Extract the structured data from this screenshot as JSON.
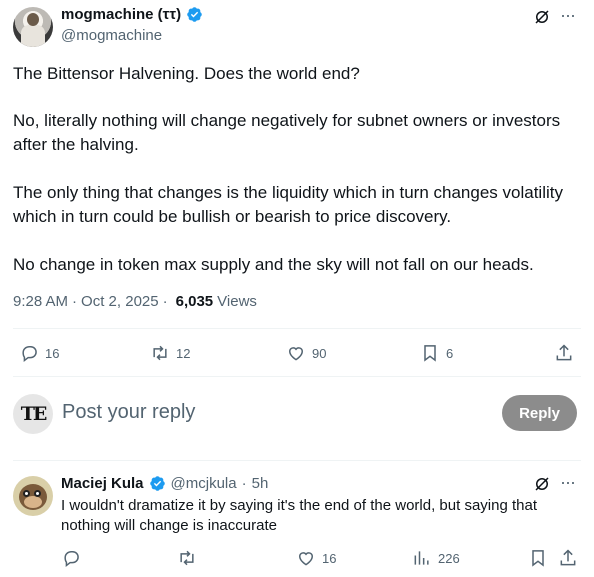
{
  "tweet": {
    "display_name": "mogmachine (ττ)",
    "handle": "@mogmachine",
    "paragraphs": [
      "The Bittensor Halvening. Does the world end?",
      "No, literally nothing will change negatively for subnet owners or investors after the halving.",
      "The only thing that changes is the liquidity which in turn changes volatility which in turn could be bullish or bearish to price discovery.",
      "No change in token max supply and the sky will not fall on our heads."
    ],
    "time": "9:28 AM",
    "date": "Oct 2, 2025",
    "views_count": "6,035",
    "views_label": "Views",
    "metrics": {
      "replies": "16",
      "reposts": "12",
      "likes": "90",
      "bookmarks": "6"
    }
  },
  "composer": {
    "avatar_text": "TE",
    "placeholder": "Post your reply",
    "button_label": "Reply"
  },
  "reply": {
    "display_name": "Maciej Kula",
    "handle": "@mcjkula",
    "time_ago": "5h",
    "text": "I wouldn't dramatize it by saying it's the end of the world, but saying that nothing will change is inaccurate",
    "metrics": {
      "likes": "16",
      "views": "226"
    }
  },
  "colors": {
    "verified": "#1d9bf0",
    "secondary_text": "#536471",
    "reply_button": "#8c8c8c"
  }
}
